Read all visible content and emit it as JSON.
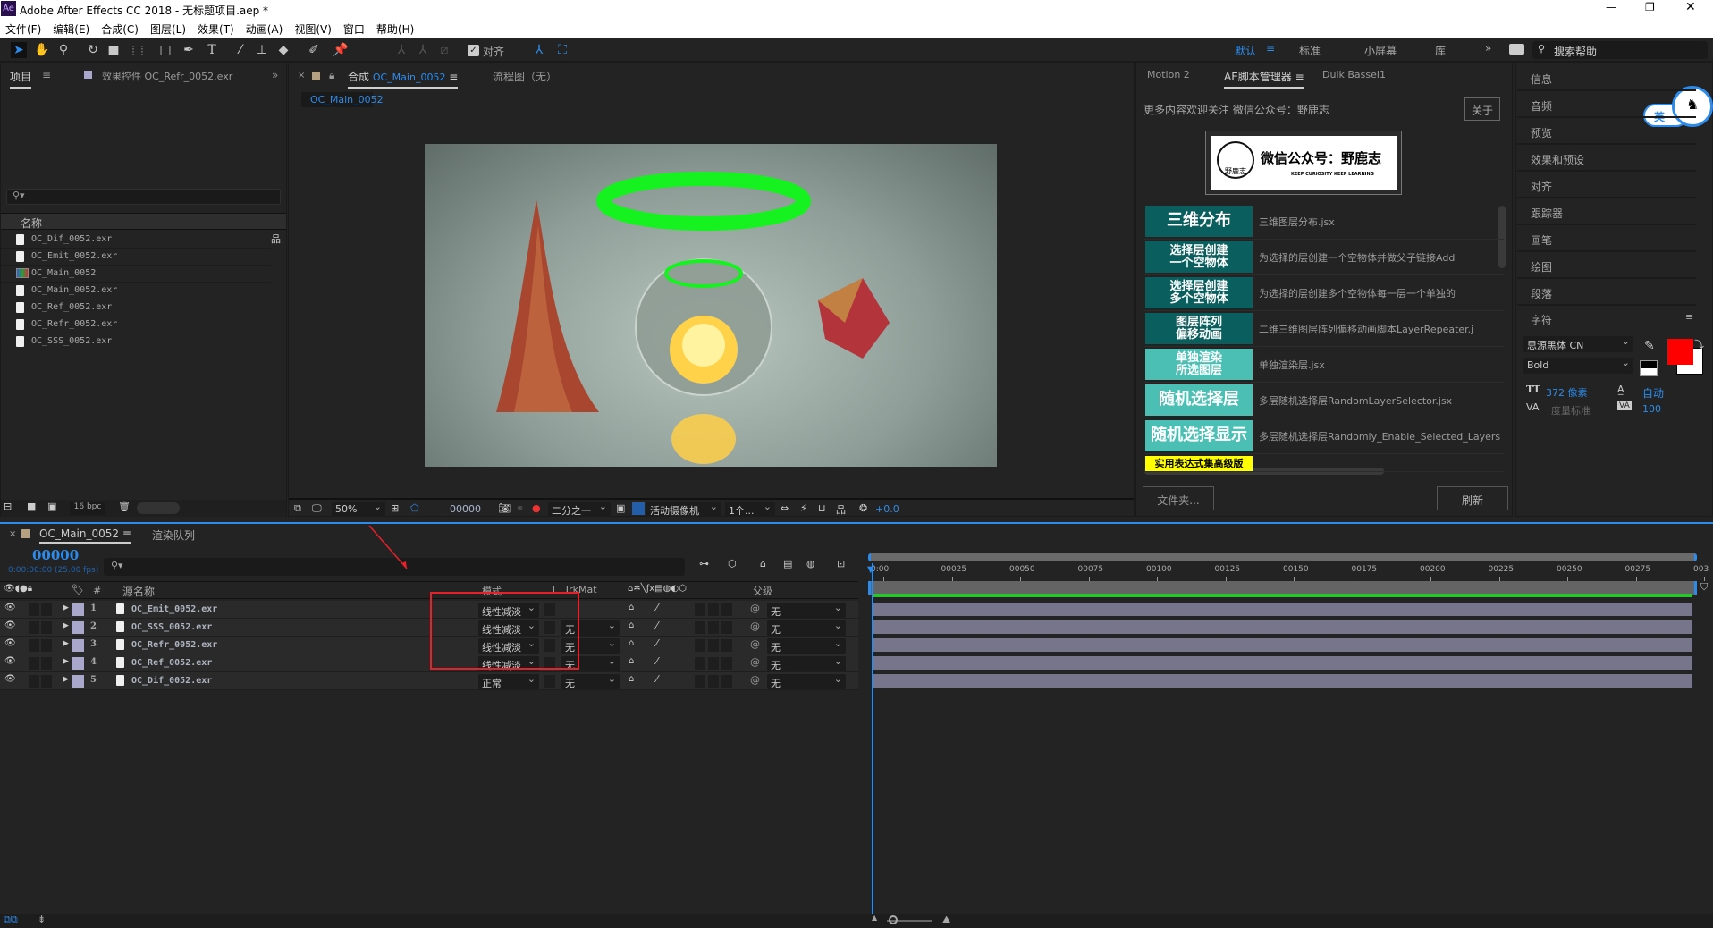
{
  "window": {
    "app_icon": "Ae",
    "title": "Adobe After Effects CC 2018 - 无标题项目.aep *"
  },
  "menu": [
    "文件(F)",
    "编辑(E)",
    "合成(C)",
    "图层(L)",
    "效果(T)",
    "动画(A)",
    "视图(V)",
    "窗口",
    "帮助(H)"
  ],
  "toolbar": {
    "align_label": "对齐",
    "workspaces": [
      "默认",
      "标准",
      "小屏幕",
      "库"
    ],
    "active_workspace": "默认",
    "search_placeholder": "搜索帮助"
  },
  "project": {
    "tab_project": "项目",
    "tab_effects": "效果控件 OC_Refr_0052.exr",
    "column_name": "名称",
    "items": [
      "OC_Dif_0052.exr",
      "OC_Emit_0052.exr",
      "OC_Main_0052",
      "OC_Main_0052.exr",
      "OC_Ref_0052.exr",
      "OC_Refr_0052.exr",
      "OC_SSS_0052.exr"
    ],
    "bpc": "16 bpc"
  },
  "viewer": {
    "tab_prefix": "合成",
    "tab_comp": "OC_Main_0052",
    "tab_flow": "流程图（无）",
    "breadcrumb": "OC_Main_0052",
    "zoom": "50%",
    "timecode": "00000",
    "resolution": "二分之一",
    "camera": "活动摄像机",
    "views": "1个...",
    "exposure": "+0.0"
  },
  "scripts": {
    "tabs": [
      "Motion 2",
      "AE脚本管理器",
      "Duik Bassel1"
    ],
    "active_tab": "AE脚本管理器",
    "notice": "更多内容欢迎关注 微信公众号：野鹿志",
    "about": "关于",
    "banner_title": "微信公众号：野鹿志",
    "banner_sub": "KEEP CURIOSITY KEEP LEARNING",
    "logo_text": "野鹿志",
    "items": [
      {
        "label": "三维分布",
        "desc": "三维图层分布.jsx",
        "color": "#0b5e5e"
      },
      {
        "label": "选择层创建\n一个空物体",
        "desc": "为选择的层创建一个空物体并做父子链接Add",
        "color": "#0b5e5e"
      },
      {
        "label": "选择层创建\n多个空物体",
        "desc": "为选择的层创建多个空物体每一层一个单独的",
        "color": "#0b5e5e"
      },
      {
        "label": "图层阵列\n偏移动画",
        "desc": "二维三维图层阵列偏移动画脚本LayerRepeater.j",
        "color": "#0b5e5e"
      },
      {
        "label": "单独渲染\n所选图层",
        "desc": "单独渲染层.jsx",
        "color": "#4bbfb4"
      },
      {
        "label": "随机选择层",
        "desc": "多层随机选择层RandomLayerSelector.jsx",
        "color": "#4bbfb4"
      },
      {
        "label": "随机选择显示",
        "desc": "多层随机选择层Randomly_Enable_Selected_Layers",
        "color": "#4bbfb4"
      },
      {
        "label": "实用表达式集高级版",
        "desc": "",
        "color": "#ffff00"
      }
    ],
    "folder_btn": "文件夹...",
    "refresh_btn": "刷新"
  },
  "right_panel": {
    "items": [
      "信息",
      "音频",
      "预览",
      "效果和预设",
      "对齐",
      "跟踪器",
      "画笔",
      "绘图",
      "段落"
    ],
    "char_title": "字符",
    "font": "思源黑体 CN",
    "style": "Bold",
    "size": "372 像素",
    "leading": "自动",
    "kerning": "度量标准",
    "tracking": "100",
    "fill_color": "#ff0000",
    "ime_badge": "英"
  },
  "timeline": {
    "tab_comp": "OC_Main_0052",
    "tab_render": "渲染队列",
    "timecode": "00000",
    "timecode_sub": "0:00:00:00 (25.00 fps)",
    "col_source": "源名称",
    "col_mode": "模式",
    "col_t": "T",
    "col_trkmat": "TrkMat",
    "col_parent": "父级",
    "ruler": [
      "0:00",
      "00025",
      "00050",
      "00075",
      "00100",
      "00125",
      "00150",
      "00175",
      "00200",
      "00225",
      "00250",
      "00275",
      "003"
    ],
    "layers": [
      {
        "num": "1",
        "name": "OC_Emit_0052.exr",
        "mode": "线性减淡",
        "trkmat": "",
        "parent": "无"
      },
      {
        "num": "2",
        "name": "OC_SSS_0052.exr",
        "mode": "线性减淡",
        "trkmat": "无",
        "parent": "无"
      },
      {
        "num": "3",
        "name": "OC_Refr_0052.exr",
        "mode": "线性减淡",
        "trkmat": "无",
        "parent": "无"
      },
      {
        "num": "4",
        "name": "OC_Ref_0052.exr",
        "mode": "线性减淡",
        "trkmat": "无",
        "parent": "无"
      },
      {
        "num": "5",
        "name": "OC_Dif_0052.exr",
        "mode": "正常",
        "trkmat": "无",
        "parent": "无"
      }
    ],
    "label_color": "#a9a8cc",
    "annotation_color": "#e8202a"
  }
}
